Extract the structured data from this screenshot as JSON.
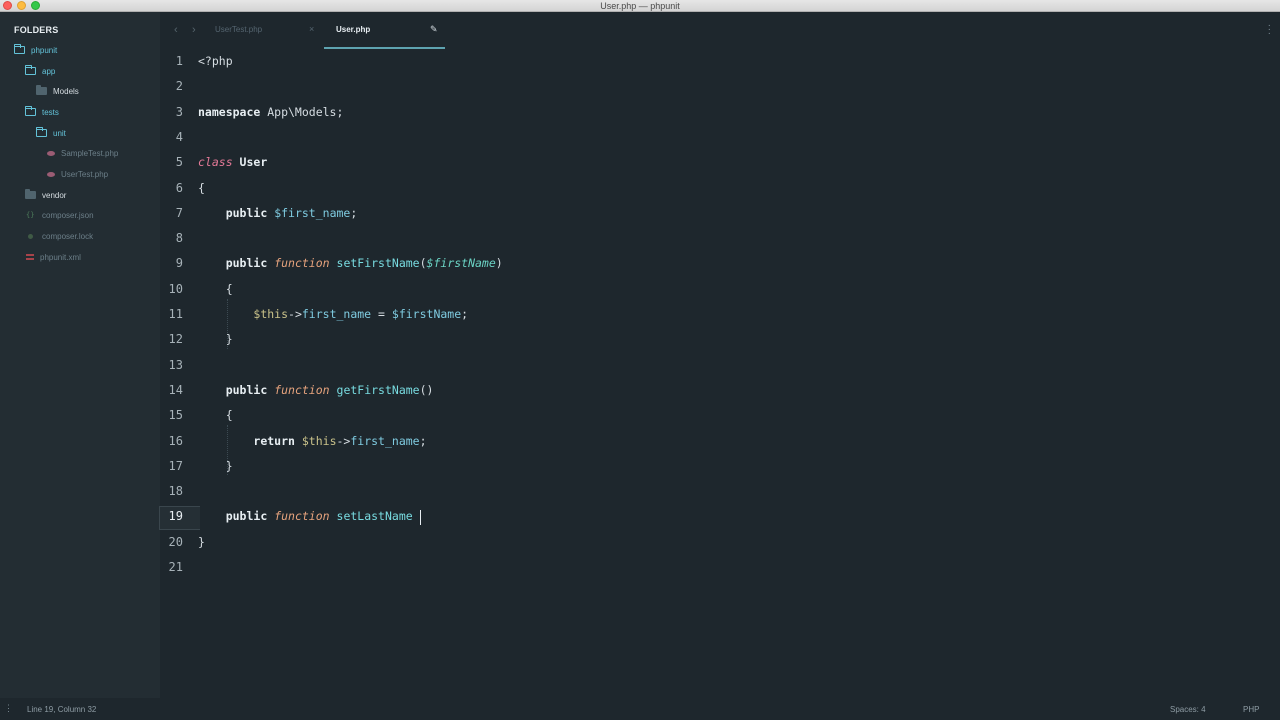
{
  "window": {
    "title": "User.php — phpunit"
  },
  "sidebar": {
    "heading": "FOLDERS",
    "items": [
      {
        "label": "phpunit",
        "type": "folder-open"
      },
      {
        "label": "app",
        "type": "folder-open"
      },
      {
        "label": "Models",
        "type": "folder-closed"
      },
      {
        "label": "tests",
        "type": "folder-open"
      },
      {
        "label": "unit",
        "type": "folder-open"
      },
      {
        "label": "SampleTest.php",
        "type": "php"
      },
      {
        "label": "UserTest.php",
        "type": "php"
      },
      {
        "label": "vendor",
        "type": "folder-closed"
      },
      {
        "label": "composer.json",
        "type": "json"
      },
      {
        "label": "composer.lock",
        "type": "lock"
      },
      {
        "label": "phpunit.xml",
        "type": "xml"
      }
    ]
  },
  "tabs": [
    {
      "label": "UserTest.php",
      "active": false
    },
    {
      "label": "User.php",
      "active": true
    }
  ],
  "editor": {
    "line_numbers": [
      "1",
      "2",
      "3",
      "4",
      "5",
      "6",
      "7",
      "8",
      "9",
      "10",
      "11",
      "12",
      "13",
      "14",
      "15",
      "16",
      "17",
      "18",
      "19",
      "20",
      "21"
    ],
    "current_line": "19",
    "lines": [
      [
        [
          "plain",
          "<?php"
        ]
      ],
      [],
      [
        [
          "kw",
          "namespace"
        ],
        [
          "plain",
          " App\\Models;"
        ]
      ],
      [],
      [
        [
          "cls-kw",
          "class"
        ],
        [
          "kw",
          " User"
        ]
      ],
      [
        [
          "plain",
          "{"
        ]
      ],
      [
        [
          "plain",
          "    "
        ],
        [
          "kw",
          "public"
        ],
        [
          "plain",
          " "
        ],
        [
          "var",
          "$first_name"
        ],
        [
          "plain",
          ";"
        ]
      ],
      [],
      [
        [
          "plain",
          "    "
        ],
        [
          "kw",
          "public"
        ],
        [
          "plain",
          " "
        ],
        [
          "fn-kw",
          "function"
        ],
        [
          "plain",
          " "
        ],
        [
          "fn",
          "setFirstName"
        ],
        [
          "plain",
          "("
        ],
        [
          "var-it",
          "$firstName"
        ],
        [
          "plain",
          ")"
        ]
      ],
      [
        [
          "plain",
          "    {"
        ]
      ],
      [
        [
          "plain",
          "        "
        ],
        [
          "this",
          "$this"
        ],
        [
          "plain",
          "->"
        ],
        [
          "prop",
          "first_name"
        ],
        [
          "plain",
          " = "
        ],
        [
          "var",
          "$firstName"
        ],
        [
          "plain",
          ";"
        ]
      ],
      [
        [
          "plain",
          "    }"
        ]
      ],
      [],
      [
        [
          "plain",
          "    "
        ],
        [
          "kw",
          "public"
        ],
        [
          "plain",
          " "
        ],
        [
          "fn-kw",
          "function"
        ],
        [
          "plain",
          " "
        ],
        [
          "fn",
          "getFirstName"
        ],
        [
          "plain",
          "()"
        ]
      ],
      [
        [
          "plain",
          "    {"
        ]
      ],
      [
        [
          "plain",
          "        "
        ],
        [
          "kw",
          "return"
        ],
        [
          "plain",
          " "
        ],
        [
          "this",
          "$this"
        ],
        [
          "plain",
          "->"
        ],
        [
          "prop",
          "first_name"
        ],
        [
          "plain",
          ";"
        ]
      ],
      [
        [
          "plain",
          "    }"
        ]
      ],
      [],
      [
        [
          "plain",
          "    "
        ],
        [
          "kw",
          "public"
        ],
        [
          "plain",
          " "
        ],
        [
          "fn-kw",
          "function"
        ],
        [
          "plain",
          " "
        ],
        [
          "fn",
          "setLastName"
        ]
      ],
      [
        [
          "plain",
          "}"
        ]
      ],
      []
    ]
  },
  "status": {
    "position": "Line 19, Column 32",
    "indentation": "Spaces: 4",
    "syntax": "PHP"
  }
}
